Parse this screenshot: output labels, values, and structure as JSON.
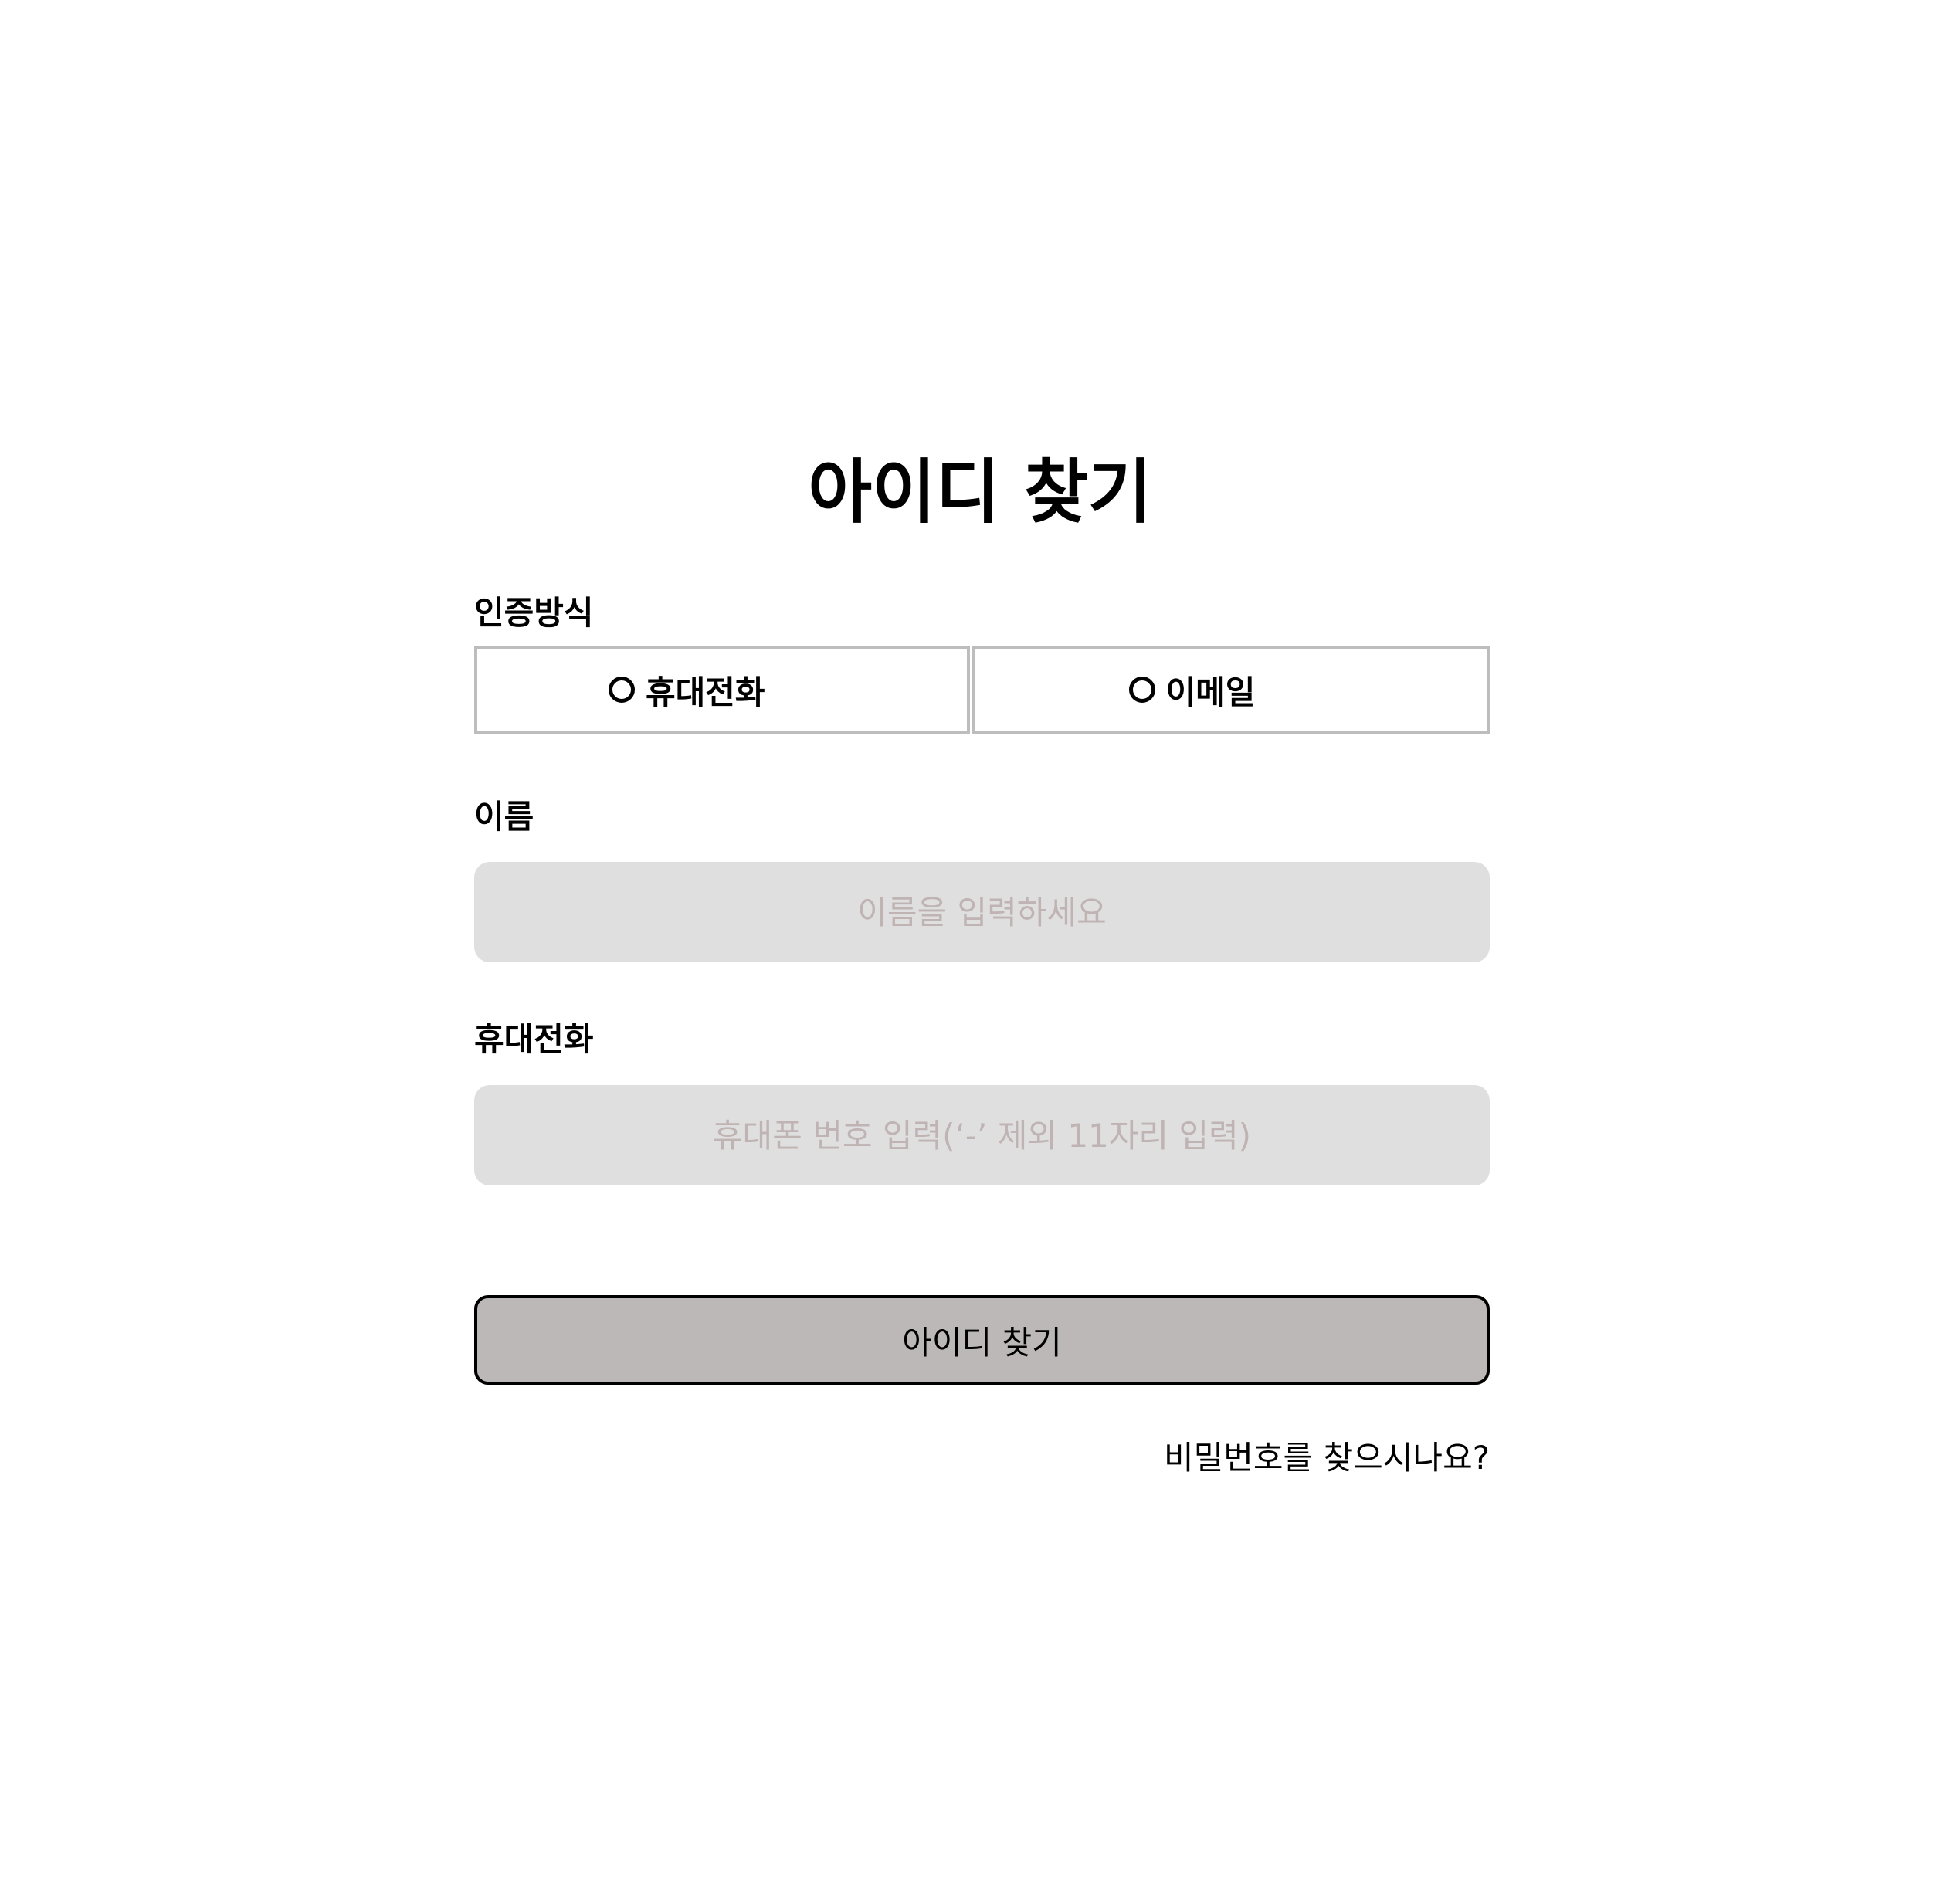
{
  "title": "아이디 찾기",
  "auth_method": {
    "label": "인증방식",
    "options": [
      {
        "label": "휴대전화"
      },
      {
        "label": "이메일"
      }
    ]
  },
  "name_field": {
    "label": "이름",
    "placeholder": "이름을 입력하세요",
    "value": ""
  },
  "phone_field": {
    "label": "휴대전화",
    "placeholder": "휴대폰 번호 입력(‘-’ 제외 11자리 입력)",
    "value": ""
  },
  "submit_label": "아이디 찾기",
  "find_password_link": "비밀번호를 찾으시나요?",
  "colors": {
    "input_background": "#dfdfdf",
    "placeholder": "#bfb3b3",
    "button_background": "#bcb8b7",
    "option_border": "#bdbdbd"
  }
}
